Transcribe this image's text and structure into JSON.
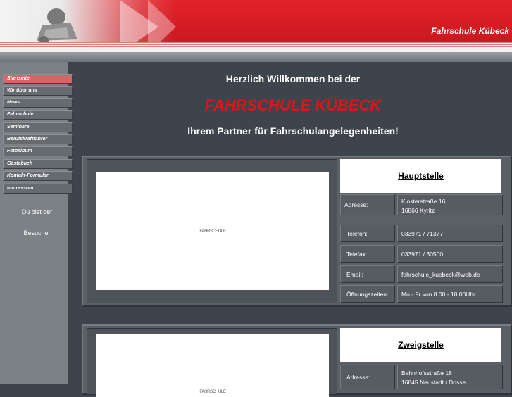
{
  "header": {
    "brand": "Fahrschule Kübeck"
  },
  "nav": {
    "items": [
      {
        "label": "Startseite",
        "active": true
      },
      {
        "label": "Wir über uns"
      },
      {
        "label": "News"
      },
      {
        "label": "Fahrschule"
      },
      {
        "label": "Seminare"
      },
      {
        "label": "Berufskraftfahrer"
      },
      {
        "label": "Fotoalbum"
      },
      {
        "label": "Gästebuch"
      },
      {
        "label": "Kontakt-Formular"
      },
      {
        "label": "Impressum"
      }
    ]
  },
  "visitor": {
    "line1": "Du bist der",
    "line2": "Besucher"
  },
  "intro": {
    "greeting": "Herzlich Willkommen bei der",
    "company": "FAHRSCHULE KÜBECK",
    "tagline": "Ihrem Partner für Fahrschulangelegenheiten!"
  },
  "main_office": {
    "photo_label": "FAHRSCHULE",
    "title": "Hauptstelle",
    "address_label": "Adresse:",
    "address_line1": "Klosterstraße 16",
    "address_line2": "16866 Kyritz",
    "phone_label": "Telefon:",
    "phone": "033971 / 71377",
    "fax_label": "Telefax:",
    "fax": "033971 / 30500",
    "email_label": "Email:",
    "email": "fahrschule_kuebeck@web.de",
    "hours_label": "Öffnungszeiten:",
    "hours": "Mo - Fr von 8.00 - 18.00Uhr"
  },
  "branch_office": {
    "photo_label": "FAHRSCHULE",
    "title": "Zweigstelle",
    "address_label": "Adresse:",
    "address_line1": "Bahnhofsstraße 18",
    "address_line2": "16845 Neustadt / Dosse"
  }
}
